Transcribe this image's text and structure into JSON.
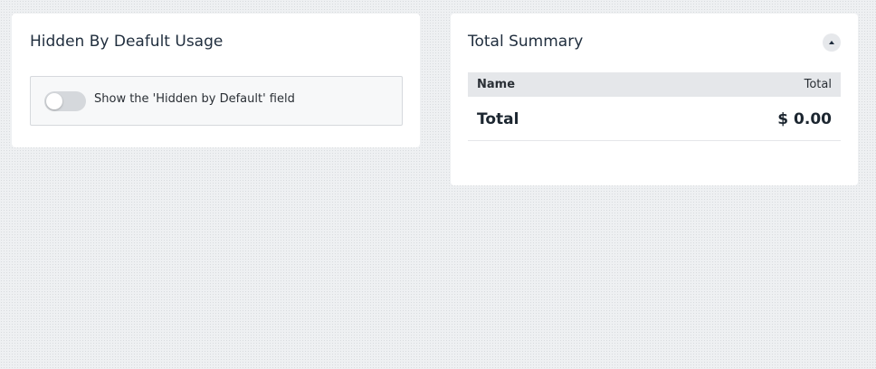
{
  "hidden_card": {
    "title": "Hidden By Deafult Usage",
    "toggle": {
      "label": "Show the 'Hidden by Default' field",
      "checked": false
    }
  },
  "summary_card": {
    "title": "Total Summary",
    "collapse_icon": "caret-up-icon",
    "table": {
      "headers": {
        "name": "Name",
        "total": "Total"
      },
      "rows": [
        {
          "name": "Total",
          "total": "$ 0.00"
        }
      ]
    }
  },
  "colors": {
    "background": "#eef0f2",
    "card": "#ffffff",
    "toggle_off": "#d5d8dc",
    "table_header": "#e5e7ea"
  }
}
